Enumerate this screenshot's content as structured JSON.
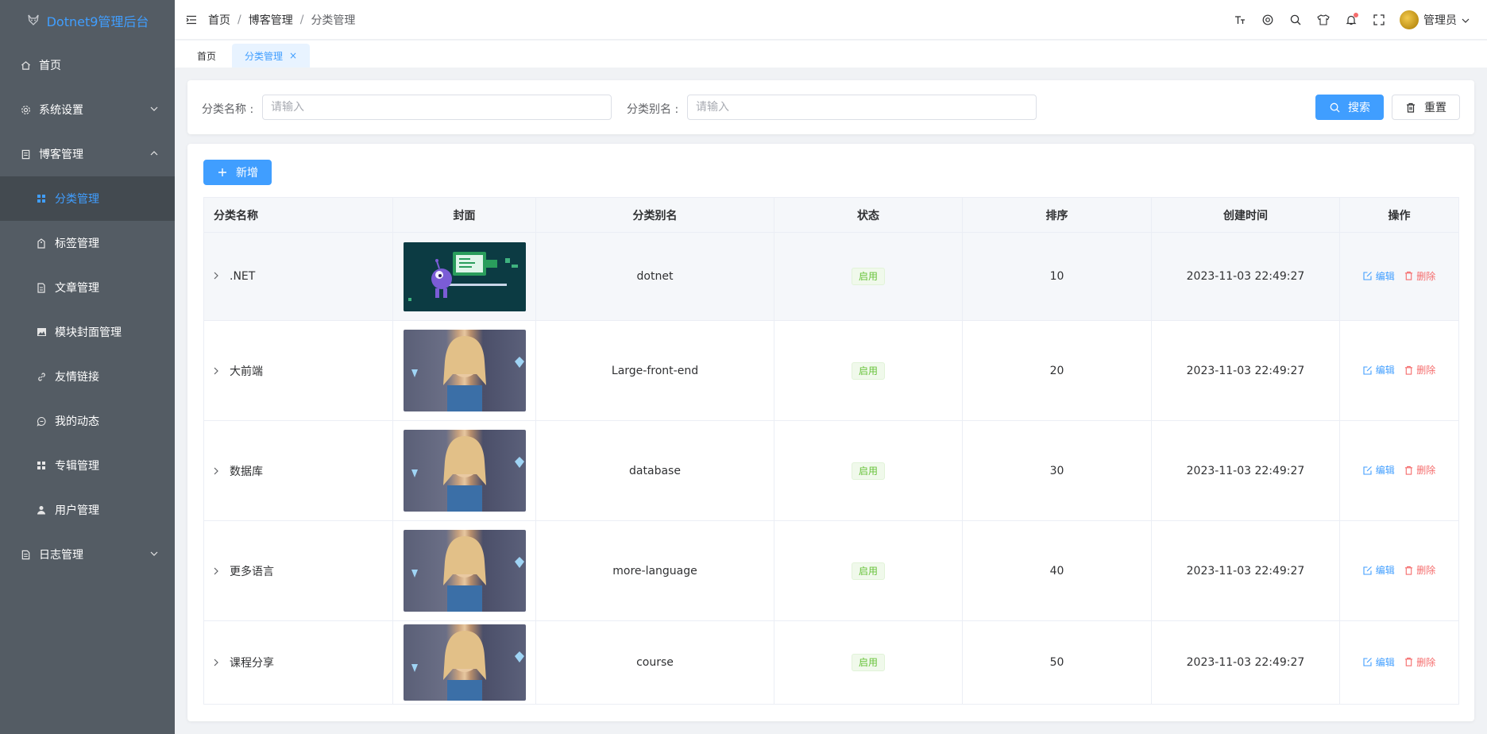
{
  "app": {
    "title": "Dotnet9管理后台"
  },
  "sidebar": {
    "items": [
      {
        "label": "首页",
        "icon": "home-icon"
      },
      {
        "label": "系统设置",
        "icon": "gear-icon",
        "expandable": true,
        "expanded": false
      },
      {
        "label": "博客管理",
        "icon": "document-icon",
        "expandable": true,
        "expanded": true
      },
      {
        "label": "日志管理",
        "icon": "log-icon",
        "expandable": true,
        "expanded": false
      }
    ],
    "blog_children": [
      {
        "label": "分类管理",
        "icon": "grid-icon",
        "active": true
      },
      {
        "label": "标签管理",
        "icon": "tag-icon"
      },
      {
        "label": "文章管理",
        "icon": "article-icon"
      },
      {
        "label": "模块封面管理",
        "icon": "picture-icon"
      },
      {
        "label": "友情链接",
        "icon": "link-icon"
      },
      {
        "label": "我的动态",
        "icon": "chat-icon"
      },
      {
        "label": "专辑管理",
        "icon": "grid-icon"
      },
      {
        "label": "用户管理",
        "icon": "user-icon"
      }
    ]
  },
  "header": {
    "breadcrumb": [
      "首页",
      "博客管理",
      "分类管理"
    ],
    "separator": "/",
    "user_name": "管理员"
  },
  "tabs": [
    {
      "label": "首页",
      "active": false
    },
    {
      "label": "分类管理",
      "active": true,
      "close": "×"
    }
  ],
  "search": {
    "name_label": "分类名称 :",
    "name_placeholder": "请输入",
    "alias_label": "分类别名 :",
    "alias_placeholder": "请输入",
    "search_button": "搜索",
    "reset_button": "重置"
  },
  "toolbar": {
    "add_button": "新增"
  },
  "table": {
    "columns": [
      "分类名称",
      "封面",
      "分类别名",
      "状态",
      "排序",
      "创建时间",
      "操作"
    ],
    "rows": [
      {
        "name": ".NET",
        "alias": "dotnet",
        "status": "启用",
        "sort": "10",
        "created": "2023-11-03 22:49:27",
        "edit": "编辑",
        "delete": "删除"
      },
      {
        "name": "大前端",
        "alias": "Large-front-end",
        "status": "启用",
        "sort": "20",
        "created": "2023-11-03 22:49:27",
        "edit": "编辑",
        "delete": "删除"
      },
      {
        "name": "数据库",
        "alias": "database",
        "status": "启用",
        "sort": "30",
        "created": "2023-11-03 22:49:27",
        "edit": "编辑",
        "delete": "删除"
      },
      {
        "name": "更多语言",
        "alias": "more-language",
        "status": "启用",
        "sort": "40",
        "created": "2023-11-03 22:49:27",
        "edit": "编辑",
        "delete": "删除"
      },
      {
        "name": "课程分享",
        "alias": "course",
        "status": "启用",
        "sort": "50",
        "created": "2023-11-03 22:49:27",
        "edit": "编辑",
        "delete": "删除"
      }
    ]
  },
  "colors": {
    "sidebar_bg": "#545c64",
    "primary": "#409eff",
    "danger": "#f56c6c",
    "success": "#67c23a"
  }
}
